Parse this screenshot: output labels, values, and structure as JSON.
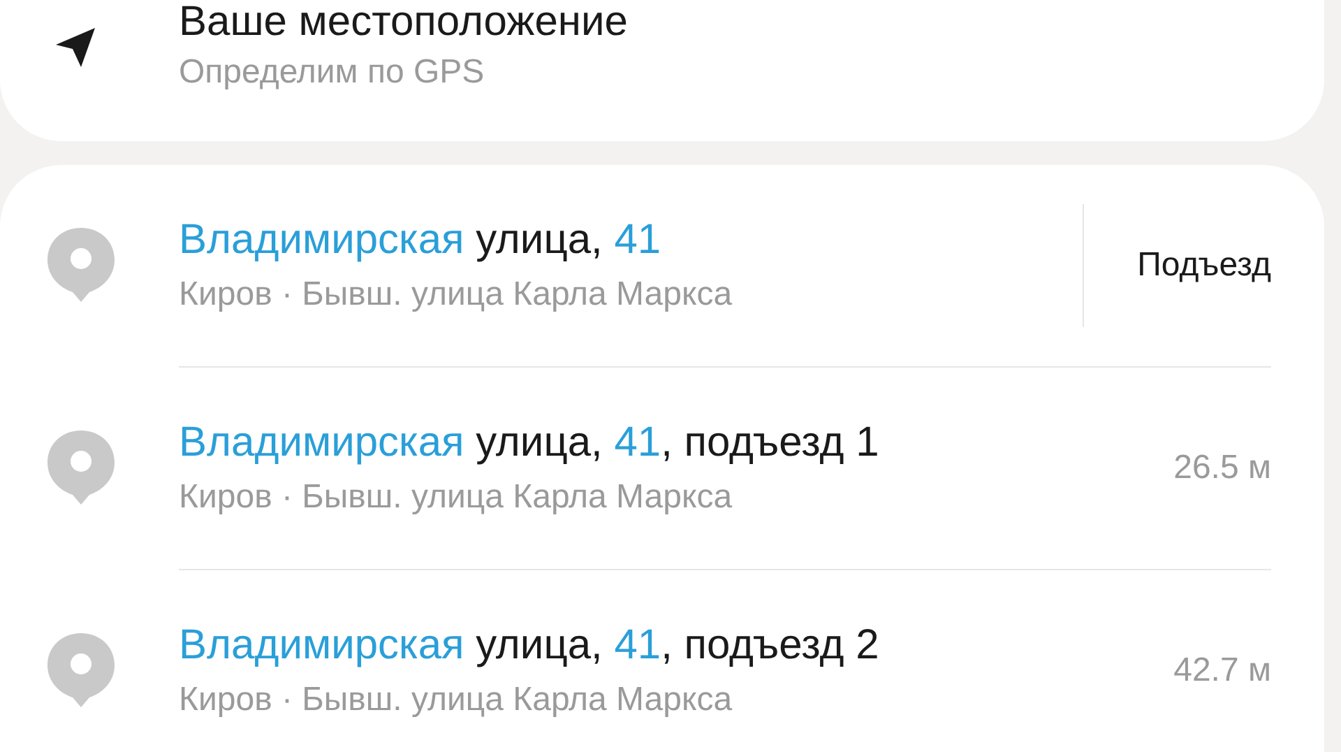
{
  "location": {
    "title": "Ваше местоположение",
    "subtitle": "Определим по GPS"
  },
  "results": [
    {
      "title": [
        {
          "text": "Владимирская",
          "highlight": true
        },
        {
          "text": " улица, ",
          "highlight": false
        },
        {
          "text": "41",
          "highlight": true
        }
      ],
      "subtitle": "Киров · Бывш. улица Карла Маркса",
      "side": {
        "kind": "action",
        "text": "Подъезд"
      }
    },
    {
      "title": [
        {
          "text": "Владимирская",
          "highlight": true
        },
        {
          "text": " улица, ",
          "highlight": false
        },
        {
          "text": "41",
          "highlight": true
        },
        {
          "text": ", подъезд 1",
          "highlight": false
        }
      ],
      "subtitle": "Киров · Бывш. улица Карла Маркса",
      "side": {
        "kind": "distance",
        "text": "26.5 м"
      }
    },
    {
      "title": [
        {
          "text": "Владимирская",
          "highlight": true
        },
        {
          "text": " улица, ",
          "highlight": false
        },
        {
          "text": "41",
          "highlight": true
        },
        {
          "text": ", подъезд 2",
          "highlight": false
        }
      ],
      "subtitle": "Киров · Бывш. улица Карла Маркса",
      "side": {
        "kind": "distance",
        "text": "42.7 м"
      }
    }
  ]
}
